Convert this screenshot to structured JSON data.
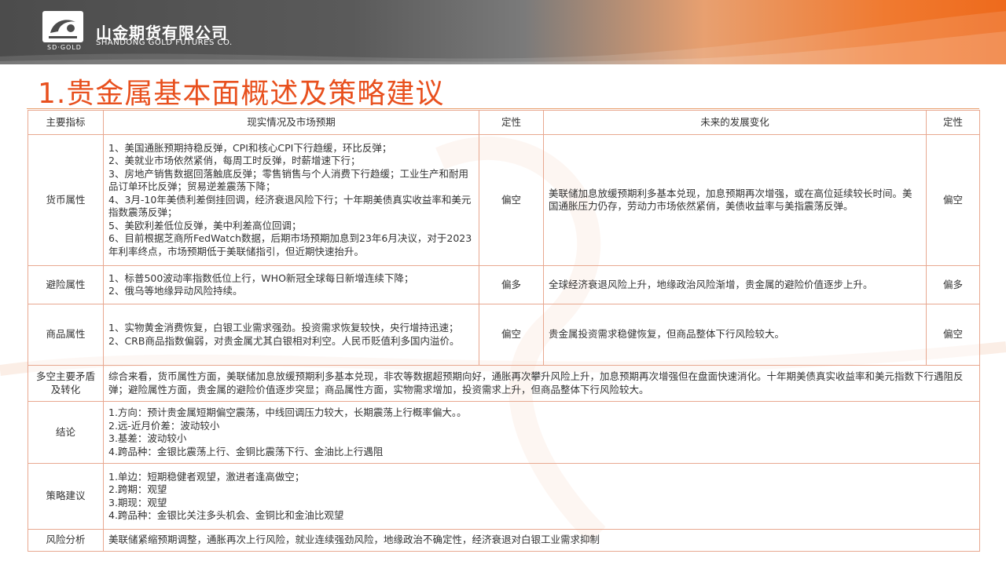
{
  "brand": {
    "logo_sub": "SD·GOLD",
    "name_cn": "山金期货有限公司",
    "name_en": "SHANDONG GOLD FUTURES CO."
  },
  "page_title": "1.贵金属基本面概述及策略建议",
  "table": {
    "headers": [
      "主要指标",
      "现实情况及市场预期",
      "定性",
      "未来的发展变化",
      "定性"
    ],
    "rows": {
      "currency": {
        "label": "货币属性",
        "reality": "1、美国通胀预期持稳反弹，CPI和核心CPI下行趋缓，环比反弹；\n2、美就业市场依然紧俏，每周工时反弹，时薪增速下行；\n3、房地产销售数据回落触底反弹；零售销售与个人消费下行趋缓；工业生产和耐用品订单环比反弹；贸易逆差震荡下降；\n4、3月-10年美债利差倒挂回调，经济衰退风险下行；十年期美债真实收益率和美元指数震荡反弹；\n5、美欧利差低位反弹，美中利差高位回调；\n6、目前根据芝商所FedWatch数据，后期市场预期加息到23年6月决议，对于2023年利率终点，市场预期低于美联储指引，但近期快速抬升。",
        "rating1": "偏空",
        "future": "美联储加息放缓预期利多基本兑现，加息预期再次增强，或在高位延续较长时间。美国通胀压力仍存，劳动力市场依然紧俏，美债收益率与美指震荡反弹。",
        "rating2": "偏空"
      },
      "hedge": {
        "label": "避险属性",
        "reality": "1、标普500波动率指数低位上行，WHO新冠全球每日新增连续下降；\n2、俄乌等地缘异动风险持续。",
        "rating1": "偏多",
        "future": "全球经济衰退风险上升，地缘政治风险渐增，贵金属的避险价值逐步上升。",
        "rating2": "偏多"
      },
      "commodity": {
        "label": "商品属性",
        "reality": "1、实物黄金消费恢复，白银工业需求强劲。投资需求恢复较快，央行增持迅速；\n2、CRB商品指数偏弱，对贵金属尤其白银相对利空。人民币贬值利多国内溢价。",
        "rating1": "偏空",
        "future": "贵金属投资需求稳健恢复，但商品整体下行风险较大。",
        "rating2": "偏空"
      },
      "contradiction": {
        "label": "多空主要矛盾及转化",
        "text": "综合来看，货币属性方面，美联储加息放缓预期利多基本兑现，非农等数据超预期向好，通胀再次攀升风险上升，加息预期再次增强但在盘面快速消化。十年期美债真实收益率和美元指数下行遇阻反弹；避险属性方面，贵金属的避险价值逐步突显；商品属性方面，实物需求增加，投资需求上升，但商品整体下行风险较大。"
      },
      "conclusion": {
        "label": "结论",
        "text": "1.方向：预计贵金属短期偏空震荡，中线回调压力较大，长期震荡上行概率偏大。。\n2.远-近月价差：波动较小\n3.基差：波动较小\n4.跨品种：金银比震荡上行、金铜比震荡下行、金油比上行遇阻"
      },
      "strategy": {
        "label": "策略建议",
        "text": "1.单边：短期稳健者观望，激进者逢高做空；\n2.跨期：观望\n3.期现：观望\n4.跨品种：金银比关注多头机会、金铜比和金油比观望"
      },
      "risk": {
        "label": "风险分析",
        "text": "美联储紧缩预期调整，通胀再次上行风险，就业连续强劲风险，地缘政治不确定性，经济衰退对白银工业需求抑制"
      }
    }
  },
  "colors": {
    "title": "#e8501e",
    "border": "#e8a890",
    "header_dark": "#4c4c4c",
    "header_orange": "#ee6a1c"
  }
}
